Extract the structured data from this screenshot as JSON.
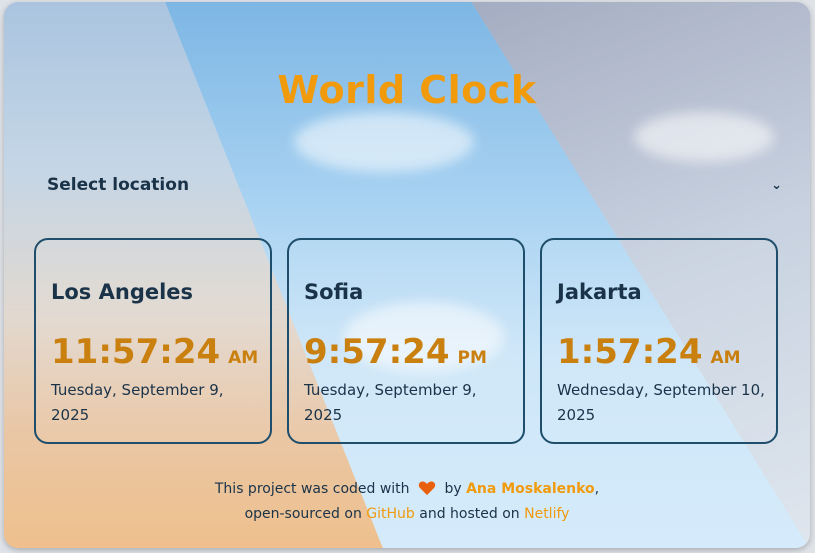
{
  "title": "World Clock",
  "select": {
    "label": "Select location"
  },
  "clocks": [
    {
      "city": "Los Angeles",
      "time": "11:57:24",
      "ampm": "AM",
      "date": "Tuesday, September 9, 2025"
    },
    {
      "city": "Sofia",
      "time": "9:57:24",
      "ampm": "PM",
      "date": "Tuesday, September 9, 2025"
    },
    {
      "city": "Jakarta",
      "time": "1:57:24",
      "ampm": "AM",
      "date": "Wednesday, September 10, 2025"
    }
  ],
  "footer": {
    "part1": "This project was coded with",
    "part2": "by",
    "author": "Ana Moskalenko",
    "comma": ",",
    "part3": "open-sourced on",
    "github": "GitHub",
    "part4": "and hosted on",
    "netlify": "Netlify"
  },
  "colors": {
    "accent": "#f09a0c",
    "text": "#1a3349",
    "time": "#c9800f",
    "border": "#1e4e6b",
    "heart": "#e8600c"
  },
  "icons": {
    "heart": "heart-icon",
    "chevron": "chevron-down-icon"
  }
}
